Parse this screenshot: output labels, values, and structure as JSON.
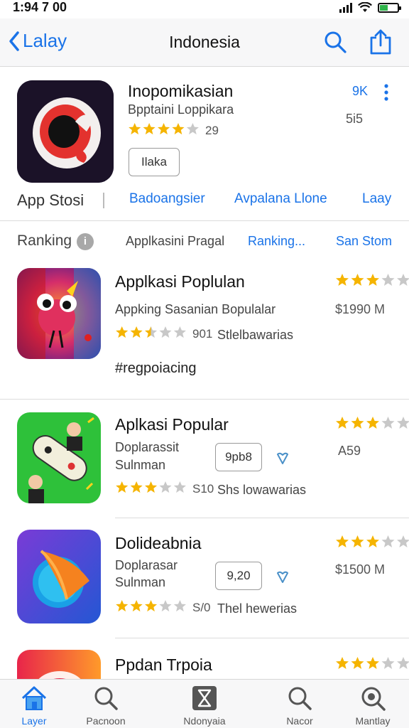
{
  "status_bar": {
    "time": "1:94 7 00"
  },
  "nav": {
    "back_label": "Lalay",
    "title": "Indonesia"
  },
  "featured": {
    "title": "Inopomikasian",
    "subtitle": "Bpptaini Loppikara",
    "rating_count": "29",
    "stars": 4,
    "open_label": "Ilaka",
    "badge": "9K",
    "size": "5i5",
    "store_label": "App Stosi",
    "links": [
      "Badoangsier",
      "Avpalana Llone",
      "Laay"
    ],
    "icon_colors": {
      "bg": "#1a1330",
      "ring": "#e8332f"
    }
  },
  "ranking": {
    "title": "Ranking",
    "tabs": [
      "Applkasini Pragal",
      "Ranking...",
      "San Stom"
    ]
  },
  "items": [
    {
      "title": "Applkasi Poplulan",
      "subtitle": "Appking Sasanian Bopulalar",
      "stars": 2.5,
      "rating_count": "901",
      "extra": "Stlelbawarias",
      "right_stars": 3,
      "price": "$1990 M",
      "tag": "#regpoiacing"
    },
    {
      "title": "Aplkasi Popular",
      "subtitle_line1": "Doplarassit",
      "subtitle_line2": "Sulnman",
      "stars": 3,
      "rating_count": "S10",
      "extra": "Shs lowawarias",
      "get_label": "9pb8",
      "right_stars": 3,
      "price": "A59"
    },
    {
      "title": "Dolideabnia",
      "subtitle_line1": "Doplarasar",
      "subtitle_line2": "Sulnman",
      "stars": 3,
      "rating_count": "S/0",
      "extra": "Thel hewerias",
      "get_label": "9,20",
      "right_stars": 3,
      "price": "$1500 M"
    },
    {
      "title": "Ppdan Trpoia",
      "right_stars": 3
    }
  ],
  "tabbar": [
    {
      "label": "Layer",
      "icon": "home-icon",
      "active": true
    },
    {
      "label": "Pacnoon",
      "icon": "search-icon",
      "active": false
    },
    {
      "label": "Ndonyaia",
      "icon": "hourglass-icon",
      "active": false
    },
    {
      "label": "Nacor",
      "icon": "search-icon",
      "active": false
    },
    {
      "label": "Mantlay",
      "icon": "magnify-icon",
      "active": false
    }
  ],
  "colors": {
    "accent": "#1a73e8",
    "star": "#f5b400",
    "star_empty": "#c8c8c8"
  }
}
